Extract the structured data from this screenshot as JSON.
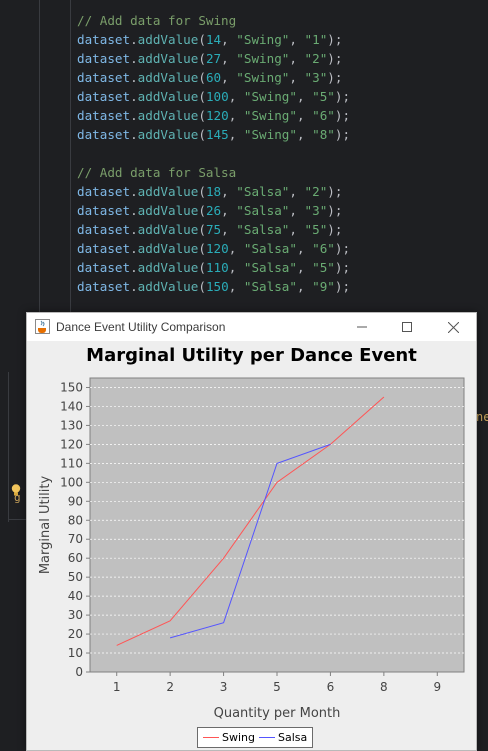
{
  "editor": {
    "code_lines": [
      [
        [
          "comment",
          "// Add data for Swing"
        ]
      ],
      [
        [
          "ident",
          "dataset"
        ],
        [
          "punc",
          "."
        ],
        [
          "method",
          "addValue"
        ],
        [
          "punc",
          "("
        ],
        [
          "num",
          "14"
        ],
        [
          "punc",
          ", "
        ],
        [
          "str",
          "\"Swing\""
        ],
        [
          "punc",
          ", "
        ],
        [
          "str",
          "\"1\""
        ],
        [
          "punc",
          ");"
        ]
      ],
      [
        [
          "ident",
          "dataset"
        ],
        [
          "punc",
          "."
        ],
        [
          "method",
          "addValue"
        ],
        [
          "punc",
          "("
        ],
        [
          "num",
          "27"
        ],
        [
          "punc",
          ", "
        ],
        [
          "str",
          "\"Swing\""
        ],
        [
          "punc",
          ", "
        ],
        [
          "str",
          "\"2\""
        ],
        [
          "punc",
          ");"
        ]
      ],
      [
        [
          "ident",
          "dataset"
        ],
        [
          "punc",
          "."
        ],
        [
          "method",
          "addValue"
        ],
        [
          "punc",
          "("
        ],
        [
          "num",
          "60"
        ],
        [
          "punc",
          ", "
        ],
        [
          "str",
          "\"Swing\""
        ],
        [
          "punc",
          ", "
        ],
        [
          "str",
          "\"3\""
        ],
        [
          "punc",
          ");"
        ]
      ],
      [
        [
          "ident",
          "dataset"
        ],
        [
          "punc",
          "."
        ],
        [
          "method",
          "addValue"
        ],
        [
          "punc",
          "("
        ],
        [
          "num",
          "100"
        ],
        [
          "punc",
          ", "
        ],
        [
          "str",
          "\"Swing\""
        ],
        [
          "punc",
          ", "
        ],
        [
          "str",
          "\"5\""
        ],
        [
          "punc",
          ");"
        ]
      ],
      [
        [
          "ident",
          "dataset"
        ],
        [
          "punc",
          "."
        ],
        [
          "method",
          "addValue"
        ],
        [
          "punc",
          "("
        ],
        [
          "num",
          "120"
        ],
        [
          "punc",
          ", "
        ],
        [
          "str",
          "\"Swing\""
        ],
        [
          "punc",
          ", "
        ],
        [
          "str",
          "\"6\""
        ],
        [
          "punc",
          ");"
        ]
      ],
      [
        [
          "ident",
          "dataset"
        ],
        [
          "punc",
          "."
        ],
        [
          "method",
          "addValue"
        ],
        [
          "punc",
          "("
        ],
        [
          "num",
          "145"
        ],
        [
          "punc",
          ", "
        ],
        [
          "str",
          "\"Swing\""
        ],
        [
          "punc",
          ", "
        ],
        [
          "str",
          "\"8\""
        ],
        [
          "punc",
          ");"
        ]
      ],
      [],
      [
        [
          "comment",
          "// Add data for Salsa"
        ]
      ],
      [
        [
          "ident",
          "dataset"
        ],
        [
          "punc",
          "."
        ],
        [
          "method",
          "addValue"
        ],
        [
          "punc",
          "("
        ],
        [
          "num",
          "18"
        ],
        [
          "punc",
          ", "
        ],
        [
          "str",
          "\"Salsa\""
        ],
        [
          "punc",
          ", "
        ],
        [
          "str",
          "\"2\""
        ],
        [
          "punc",
          ");"
        ]
      ],
      [
        [
          "ident",
          "dataset"
        ],
        [
          "punc",
          "."
        ],
        [
          "method",
          "addValue"
        ],
        [
          "punc",
          "("
        ],
        [
          "num",
          "26"
        ],
        [
          "punc",
          ", "
        ],
        [
          "str",
          "\"Salsa\""
        ],
        [
          "punc",
          ", "
        ],
        [
          "str",
          "\"3\""
        ],
        [
          "punc",
          ");"
        ]
      ],
      [
        [
          "ident",
          "dataset"
        ],
        [
          "punc",
          "."
        ],
        [
          "method",
          "addValue"
        ],
        [
          "punc",
          "("
        ],
        [
          "num",
          "75"
        ],
        [
          "punc",
          ", "
        ],
        [
          "str",
          "\"Salsa\""
        ],
        [
          "punc",
          ", "
        ],
        [
          "str",
          "\"5\""
        ],
        [
          "punc",
          ");"
        ]
      ],
      [
        [
          "ident",
          "dataset"
        ],
        [
          "punc",
          "."
        ],
        [
          "method",
          "addValue"
        ],
        [
          "punc",
          "("
        ],
        [
          "num",
          "120"
        ],
        [
          "punc",
          ", "
        ],
        [
          "str",
          "\"Salsa\""
        ],
        [
          "punc",
          ", "
        ],
        [
          "str",
          "\"6\""
        ],
        [
          "punc",
          ");"
        ]
      ],
      [
        [
          "ident",
          "dataset"
        ],
        [
          "punc",
          "."
        ],
        [
          "method",
          "addValue"
        ],
        [
          "punc",
          "("
        ],
        [
          "num",
          "110"
        ],
        [
          "punc",
          ", "
        ],
        [
          "str",
          "\"Salsa\""
        ],
        [
          "punc",
          ", "
        ],
        [
          "str",
          "\"5\""
        ],
        [
          "punc",
          ");"
        ]
      ],
      [
        [
          "ident",
          "dataset"
        ],
        [
          "punc",
          "."
        ],
        [
          "method",
          "addValue"
        ],
        [
          "punc",
          "("
        ],
        [
          "num",
          "150"
        ],
        [
          "punc",
          ", "
        ],
        [
          "str",
          "\"Salsa\""
        ],
        [
          "punc",
          ", "
        ],
        [
          "str",
          "\"9\""
        ],
        [
          "punc",
          ");"
        ]
      ]
    ],
    "right_fragment": "ne",
    "left_fragment": "g"
  },
  "window": {
    "title": "Dance Event Utility Comparison",
    "icon": "java-cup-icon",
    "controls": [
      "minimize-icon",
      "maximize-icon",
      "close-icon"
    ]
  },
  "colors": {
    "plot_background": "#c0c0c0",
    "swing": "#ff5555",
    "salsa": "#5555ff",
    "gridline": "#ffffff"
  },
  "chart_data": {
    "type": "line",
    "title": "Marginal Utility per Dance Event",
    "xlabel": "Quantity per Month",
    "ylabel": "Marginal Utility",
    "categories": [
      "1",
      "2",
      "3",
      "5",
      "6",
      "8",
      "9"
    ],
    "ylim": [
      0,
      155
    ],
    "yticks": [
      0,
      10,
      20,
      30,
      40,
      50,
      60,
      70,
      80,
      90,
      100,
      110,
      120,
      130,
      140,
      150
    ],
    "grid": true,
    "legend_position": "bottom",
    "series": [
      {
        "name": "Swing",
        "points": [
          [
            "1",
            14
          ],
          [
            "2",
            27
          ],
          [
            "3",
            60
          ],
          [
            "5",
            100
          ],
          [
            "6",
            120
          ],
          [
            "8",
            145
          ]
        ]
      },
      {
        "name": "Salsa",
        "points": [
          [
            "2",
            18
          ],
          [
            "3",
            26
          ],
          [
            "5",
            110
          ],
          [
            "6",
            120
          ]
        ]
      }
    ]
  }
}
